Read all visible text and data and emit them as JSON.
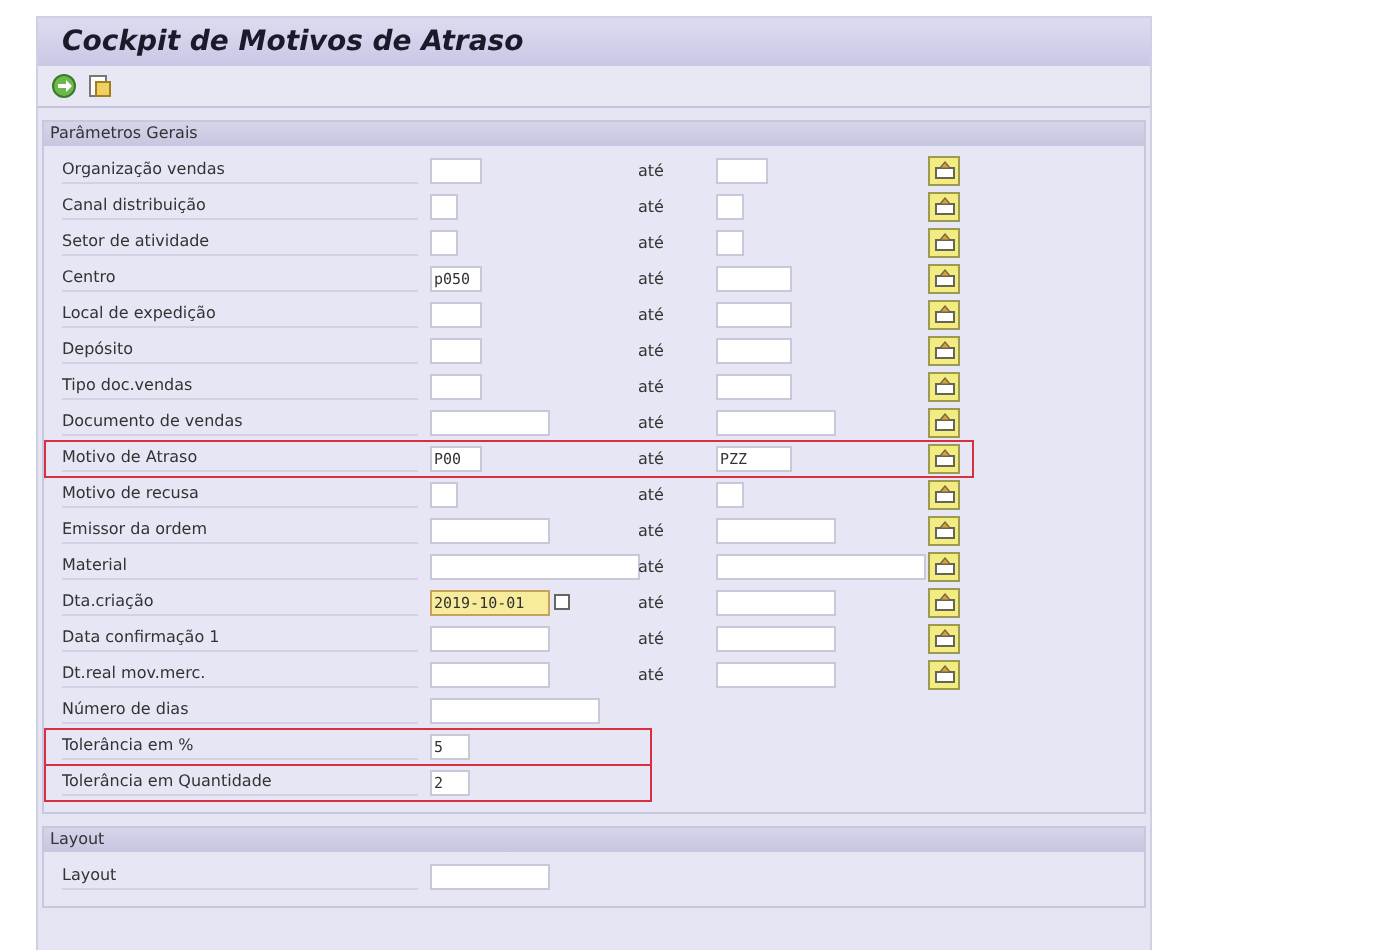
{
  "window": {
    "title": "Cockpit de Motivos de Atraso"
  },
  "toolbar": {
    "buttons": [
      {
        "kind": "execute"
      },
      {
        "kind": "variant"
      }
    ]
  },
  "sections": [
    {
      "title": "Parâmetros Gerais",
      "rows": [
        {
          "label": "Organização vendas",
          "range": {
            "label": "até"
          },
          "highlighted": false
        },
        {
          "label": "Canal distribuição",
          "range": {
            "label": "até"
          },
          "highlighted": false
        },
        {
          "label": "Setor de atividade",
          "range": {
            "label": "até"
          },
          "highlighted": false
        },
        {
          "label": "Centro",
          "from": "p050",
          "range": {
            "label": "até"
          },
          "highlighted": false
        },
        {
          "label": "Local de expedição",
          "range": {
            "label": "até"
          },
          "highlighted": false
        },
        {
          "label": "Depósito",
          "range": {
            "label": "até"
          },
          "highlighted": false
        },
        {
          "label": "Tipo doc.vendas",
          "range": {
            "label": "até"
          },
          "highlighted": false
        },
        {
          "label": "Documento de vendas",
          "range": {
            "label": "até"
          },
          "highlighted": false
        },
        {
          "label": "Motivo de Atraso",
          "from": "P00",
          "range": {
            "label": "até",
            "to": "PZZ"
          },
          "highlighted": true
        },
        {
          "label": "Motivo de recusa",
          "range": {
            "label": "até"
          },
          "highlighted": false
        },
        {
          "label": "Emissor da ordem",
          "range": {
            "label": "até"
          },
          "highlighted": false
        },
        {
          "label": "Material",
          "range": {
            "label": "até"
          },
          "highlighted": false
        },
        {
          "label": "Dta.criação",
          "from": "2019-10-01",
          "focused": true,
          "range": {
            "label": "até"
          },
          "highlighted": false
        },
        {
          "label": "Data confirmação 1",
          "range": {
            "label": "até"
          },
          "highlighted": false
        },
        {
          "label": "Dt.real mov.merc.",
          "range": {
            "label": "até"
          },
          "highlighted": false
        },
        {
          "label": "Número de dias",
          "highlighted": false
        },
        {
          "label": "Tolerância em %",
          "from": "5",
          "highlighted": true
        },
        {
          "label": "Tolerância em Quantidade",
          "from": "2",
          "highlighted": true
        }
      ]
    },
    {
      "title": "Layout",
      "rows": [
        {
          "label": "Layout",
          "highlighted": false
        }
      ]
    }
  ]
}
